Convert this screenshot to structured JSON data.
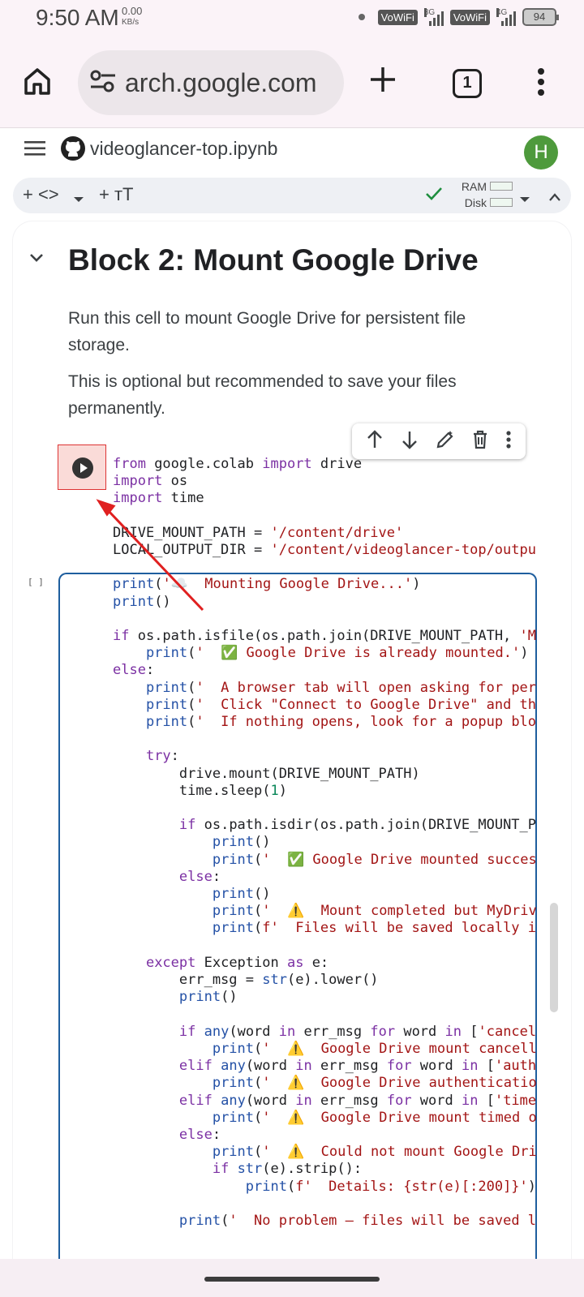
{
  "status_bar": {
    "time": "9:50 AM",
    "speed_value": "0.00",
    "speed_unit": "KB/s",
    "net1": "VoWiFi",
    "net1_type": "3G",
    "net2": "VoWiFi",
    "net2_type": "4G",
    "battery": "94"
  },
  "browser": {
    "url": "arch.google.com",
    "tab_count": "1"
  },
  "colab": {
    "notebook_name": "videoglancer-top.ipynb",
    "avatar_letter": "H",
    "toolbar": {
      "code_label": "+ <>",
      "text_label": "+ ᴛT",
      "ram_label": "RAM",
      "disk_label": "Disk"
    },
    "section_title": "Block 2: Mount Google Drive",
    "paragraph1": "Run this cell to mount Google Drive for persistent file storage.",
    "paragraph2": "This is optional but recommended to save your files permanently.",
    "execution_count": "[ ]",
    "code_lines": [
      "from google.colab import drive",
      "import os",
      "import time",
      "",
      "DRIVE_MOUNT_PATH = '/content/drive'",
      "LOCAL_OUTPUT_DIR = '/content/videoglancer-top/outpu",
      "",
      "print('☁️  Mounting Google Drive...')",
      "print()",
      "",
      "if os.path.isfile(os.path.join(DRIVE_MOUNT_PATH, 'M",
      "    print('  ✅ Google Drive is already mounted.')",
      "else:",
      "    print('  A browser tab will open asking for per",
      "    print('  Click \"Connect to Google Drive\" and th",
      "    print('  If nothing opens, look for a popup blo",
      "",
      "    try:",
      "        drive.mount(DRIVE_MOUNT_PATH)",
      "        time.sleep(1)",
      "",
      "        if os.path.isdir(os.path.join(DRIVE_MOUNT_P",
      "            print()",
      "            print('  ✅ Google Drive mounted succes",
      "        else:",
      "            print()",
      "            print('  ⚠️  Mount completed but MyDriv",
      "            print(f'  Files will be saved locally i",
      "",
      "    except Exception as e:",
      "        err_msg = str(e).lower()",
      "        print()",
      "",
      "        if any(word in err_msg for word in ['cancel",
      "            print('  ⚠️  Google Drive mount cancell",
      "        elif any(word in err_msg for word in ['auth",
      "            print('  ⚠️  Google Drive authenticatio",
      "        elif any(word in err_msg for word in ['time",
      "            print('  ⚠️  Google Drive mount timed o",
      "        else:",
      "            print('  ⚠️  Could not mount Google Dri",
      "            if str(e).strip():",
      "                print(f'  Details: {str(e)[:200]}')",
      "",
      "        print('  No problem — files will be saved l"
    ]
  }
}
